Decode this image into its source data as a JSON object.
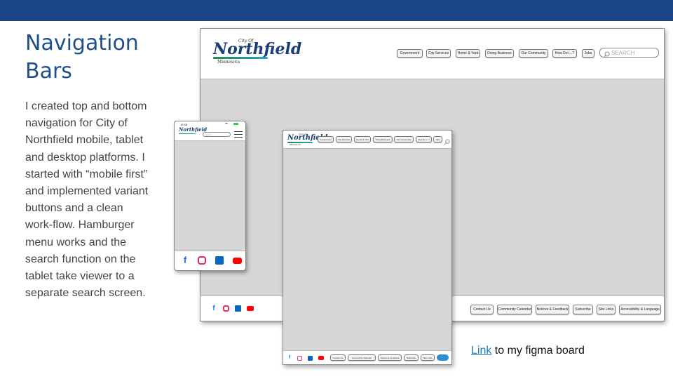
{
  "slide": {
    "title": "Navigation Bars",
    "description": "I created top and bottom navigation for City of Northfield mobile, tablet and desktop platforms.  I started with “mobile first” and implemented variant buttons and a clean work-flow. Hamburger menu works and the search function on the tablet take viewer to a separate search screen.",
    "link_text": "Link",
    "link_suffix": " to my figma board"
  },
  "brand": {
    "city_of": "City Of",
    "name": "Northfield",
    "state": "Minnesota"
  },
  "desktop": {
    "nav": [
      "Government",
      "City Services",
      "Home & Yard",
      "Doing Business",
      "Our Community",
      "How Do I...?",
      "Jobs"
    ],
    "search_placeholder": "SEARCH",
    "footer_links": [
      "Contact Us",
      "Community Calendar",
      "Notices & Feedback",
      "Subscribe",
      "Site Links",
      "Accessibility & Language"
    ]
  },
  "mobile": {
    "time": "12:48",
    "search_placeholder": "Search"
  },
  "tablet": {
    "nav": [
      "Government",
      "City Services",
      "Home & Yard",
      "Doing Business",
      "Our Community",
      "How Do I...?",
      "Jobs"
    ],
    "footer_links": [
      "Contact Us",
      "Community Calendar",
      "Notices & Feedback",
      "Subscribe",
      "Site Links"
    ]
  },
  "colors": {
    "header_bar": "#1b4589",
    "title": "#1f4e8c",
    "facebook": "#1877f2",
    "instagram": "#e1306c",
    "linkedin": "#0a66c2",
    "youtube": "#ff0000"
  },
  "icons": [
    "facebook-icon",
    "instagram-icon",
    "linkedin-icon",
    "youtube-icon",
    "search-icon",
    "hamburger-menu-icon"
  ]
}
